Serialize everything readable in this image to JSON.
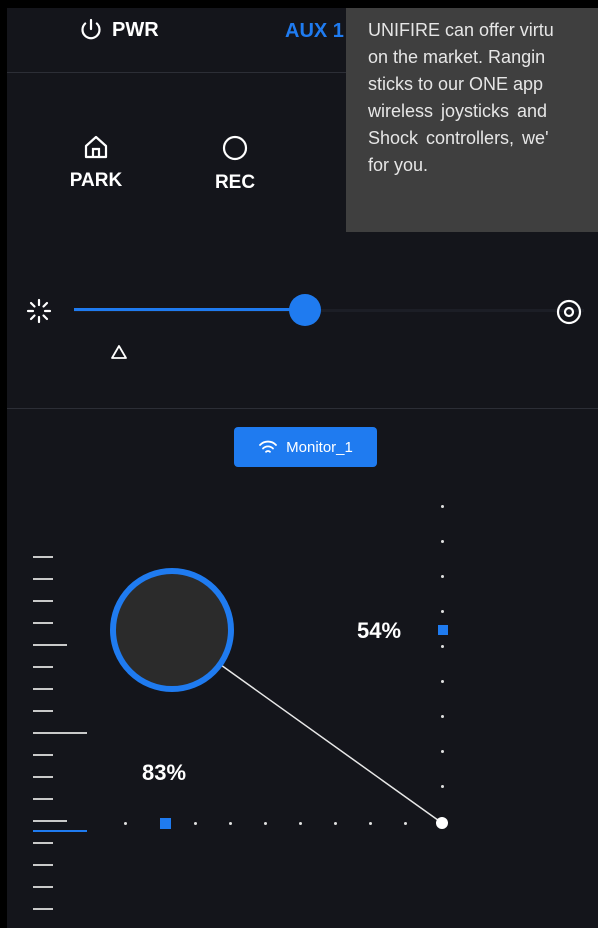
{
  "header": {
    "power_label": "PWR",
    "aux_label": "AUX 1"
  },
  "modes": [
    {
      "label": "PARK",
      "icon": "home-icon"
    },
    {
      "label": "REC",
      "icon": "circle-icon"
    }
  ],
  "tooltip": {
    "lines": [
      "UNIFIRE can offer virtu",
      "on the market. Rangin",
      "sticks to our ONE app",
      "wireless  joysticks  and",
      "Shock  controllers,  we'",
      "for you."
    ]
  },
  "slider": {
    "left_icon": "sun-spin-icon",
    "right_icon": "target-icon",
    "marker_icon": "triangle-icon",
    "fill_fraction": 0.45
  },
  "monitor": {
    "label": "Monitor_1",
    "icon": "wifi-icon"
  },
  "joystick": {
    "vertical_percent": "54%",
    "horizontal_percent": "83%"
  },
  "colors": {
    "accent": "#1f7bf0",
    "background": "#14151b",
    "tooltip_bg": "#3f3f3f"
  }
}
